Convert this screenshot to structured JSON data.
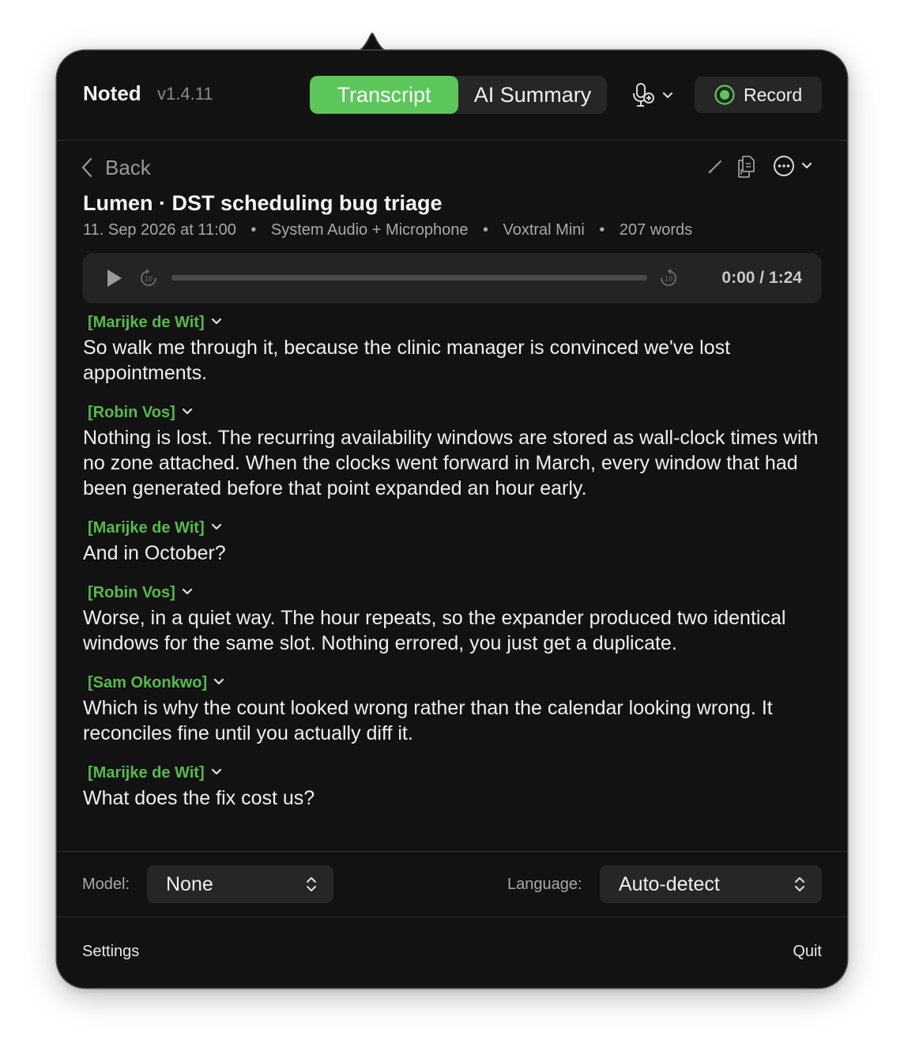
{
  "header": {
    "app_name": "Noted",
    "version": "v1.4.11",
    "tabs": [
      {
        "label": "Transcript",
        "active": true
      },
      {
        "label": "AI Summary",
        "active": false
      }
    ],
    "mic_icon": "microphone-settings-icon",
    "record_label": "Record"
  },
  "recording": {
    "back_label": "Back",
    "title": "Lumen · DST scheduling bug triage",
    "date": "11. Sep 2026 at 11:00",
    "source": "System Audio + Microphone",
    "model": "Voxtral Mini",
    "word_count": "207 words",
    "separator": "•"
  },
  "player": {
    "time": "0:00 / 1:24",
    "progress": 0
  },
  "transcript": [
    {
      "speaker": "[Marijke de Wit]",
      "text": "So walk me through it, because the clinic manager is convinced we've lost appointments."
    },
    {
      "speaker": "[Robin Vos]",
      "text": "Nothing is lost. The recurring availability windows are stored as wall-clock times with no zone attached. When the clocks went forward in March, every window that had been generated before that point expanded an hour early."
    },
    {
      "speaker": "[Marijke de Wit]",
      "text": "And in October?"
    },
    {
      "speaker": "[Robin Vos]",
      "text": "Worse, in a quiet way. The hour repeats, so the expander produced two identical windows for the same slot. Nothing errored, you just get a duplicate."
    },
    {
      "speaker": "[Sam Okonkwo]",
      "text": "Which is why the count looked wrong rather than the calendar looking wrong. It reconciles fine until you actually diff it."
    },
    {
      "speaker": "[Marijke de Wit]",
      "text": "What does the fix cost us?"
    }
  ],
  "footer": {
    "model_label": "Model:",
    "model_value": "None",
    "language_label": "Language:",
    "language_value": "Auto-detect",
    "settings_label": "Settings",
    "quit_label": "Quit"
  },
  "colors": {
    "accent": "#5cc65a",
    "speaker": "#59b84f",
    "background": "#121212",
    "control": "#262626"
  }
}
